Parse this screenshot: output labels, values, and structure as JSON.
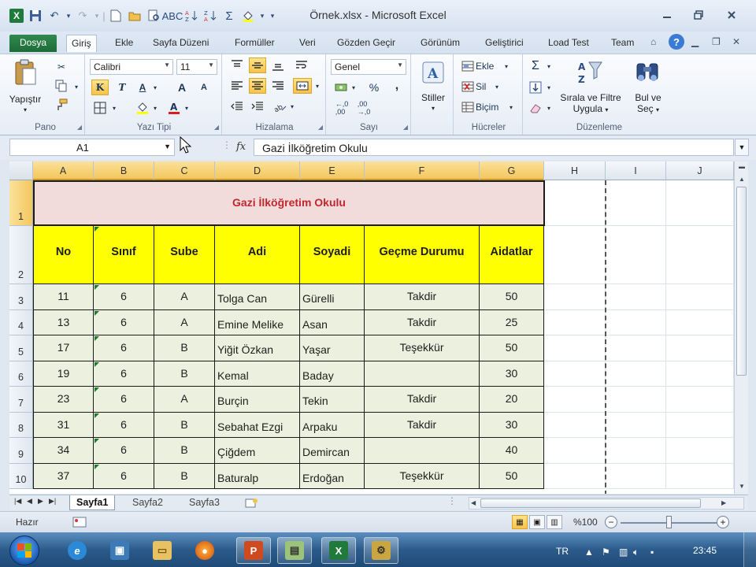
{
  "window": {
    "title": "Örnek.xlsx - Microsoft Excel",
    "minimize_icon": "minimize-icon",
    "maximize_icon": "restore-icon",
    "close_icon": "close-icon"
  },
  "tabs": {
    "file": "Dosya",
    "items": [
      "Giriş",
      "Ekle",
      "Sayfa Düzeni",
      "Formüller",
      "Veri",
      "Gözden Geçir",
      "Görünüm",
      "Geliştirici",
      "Load Test",
      "Team"
    ],
    "active": "Giriş"
  },
  "ribbon": {
    "groups": {
      "clipboard": "Pano",
      "font": "Yazı Tipi",
      "alignment": "Hizalama",
      "number": "Sayı",
      "cells": "Hücreler",
      "editing": "Düzenleme"
    },
    "paste_label": "Yapıştır",
    "font_name": "Calibri",
    "font_size": "11",
    "bold": "K",
    "italic": "T",
    "underline": "A",
    "grow_font": "A",
    "shrink_font": "A",
    "number_format": "Genel",
    "percent": "%",
    "comma": ",",
    "styles_label": "Stiller",
    "insert_label": "Ekle",
    "delete_label": "Sil",
    "format_label": "Biçim",
    "sum_symbol": "Σ",
    "sort_filter_label_1": "Sırala ve Filtre",
    "sort_filter_label_2": "Uygula",
    "find_label_1": "Bul ve",
    "find_label_2": "Seç"
  },
  "formula_bar": {
    "name_box": "A1",
    "fx": "fx",
    "content": "Gazi İlköğretim Okulu"
  },
  "sheet": {
    "columns": [
      "A",
      "B",
      "C",
      "D",
      "E",
      "F",
      "G",
      "H",
      "I",
      "J"
    ],
    "title": "Gazi İlköğretim Okulu",
    "headers": [
      "No",
      "Sınıf",
      "Sube",
      "Adi",
      "Soyadi",
      "Geçme Durumu",
      "Aidatlar"
    ],
    "rows": [
      {
        "row": "3",
        "no": "11",
        "sinif": "6",
        "sube": "A",
        "adi": "Tolga Can",
        "soyadi": "Gürelli",
        "durum": "Takdir",
        "aidat": "50"
      },
      {
        "row": "4",
        "no": "13",
        "sinif": "6",
        "sube": "A",
        "adi": "Emine Melike",
        "soyadi": "Asan",
        "durum": "Takdir",
        "aidat": "25"
      },
      {
        "row": "5",
        "no": "17",
        "sinif": "6",
        "sube": "B",
        "adi": "Yiğit Özkan",
        "soyadi": "Yaşar",
        "durum": "Teşekkür",
        "aidat": "50"
      },
      {
        "row": "6",
        "no": "19",
        "sinif": "6",
        "sube": "B",
        "adi": "Kemal",
        "soyadi": "Baday",
        "durum": "",
        "aidat": "30"
      },
      {
        "row": "7",
        "no": "23",
        "sinif": "6",
        "sube": "A",
        "adi": "Burçin",
        "soyadi": "Tekin",
        "durum": "Takdir",
        "aidat": "20"
      },
      {
        "row": "8",
        "no": "31",
        "sinif": "6",
        "sube": "B",
        "adi": "Sebahat Ezgi",
        "soyadi": "Arpaku",
        "durum": "Takdir",
        "aidat": "30"
      },
      {
        "row": "9",
        "no": "34",
        "sinif": "6",
        "sube": "B",
        "adi": "Çiğdem",
        "soyadi": "Demircan",
        "durum": "",
        "aidat": "40"
      },
      {
        "row": "10",
        "no": "37",
        "sinif": "6",
        "sube": "B",
        "adi": "Baturalp",
        "soyadi": "Erdoğan",
        "durum": "Teşekkür",
        "aidat": "50"
      }
    ],
    "row_header_1": "1",
    "row_header_2": "2"
  },
  "sheet_tabs": [
    "Sayfa1",
    "Sayfa2",
    "Sayfa3"
  ],
  "status": {
    "ready": "Hazır",
    "zoom": "%100",
    "zoom_level": 100
  },
  "taskbar": {
    "lang": "TR",
    "clock": "23:45"
  },
  "colors": {
    "header_fill": "#ffff00",
    "title_fill": "#f2dcdb",
    "title_text": "#c0272d",
    "data_fill": "#ebf1de",
    "excel_green": "#1f7a3b"
  }
}
